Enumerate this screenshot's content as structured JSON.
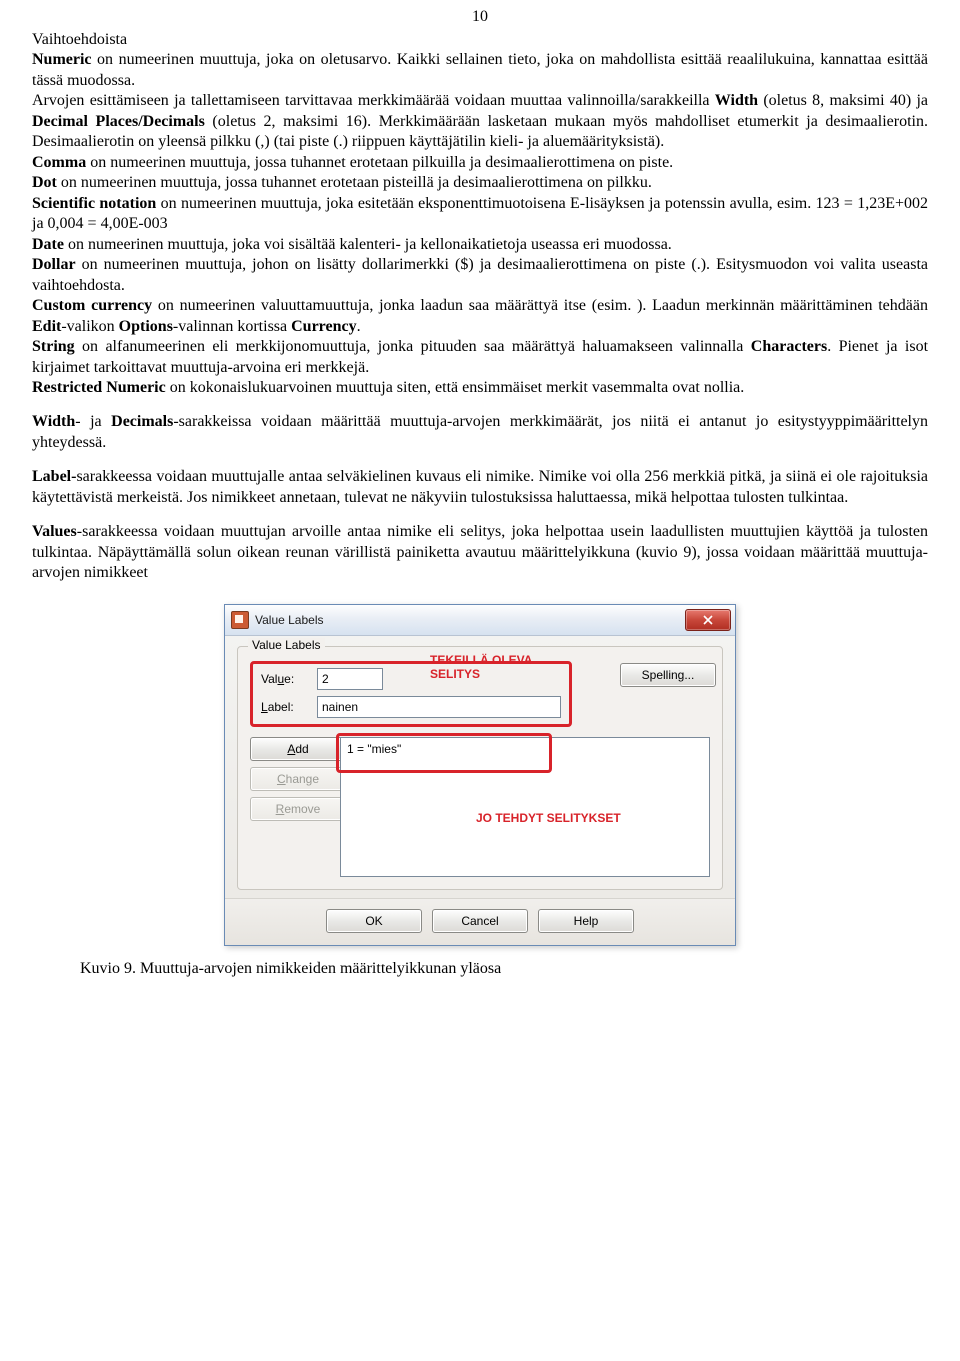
{
  "page_number": "10",
  "paragraphs": {
    "p1a": "Vaihtoehdoista",
    "p1b_label": "Numeric",
    "p1b": " on numeerinen muuttuja, joka on oletusarvo. Kaikki sellainen tieto, joka on mahdollista esittää reaalilukuina, kannattaa esittää tässä muodossa.",
    "p1c": "Arvojen esittämiseen ja tallettamiseen tarvittavaa merkkimäärää voidaan muuttaa valinnoilla/sarakkeilla ",
    "p1c_b1": "Width",
    "p1c_mid": " (oletus 8, maksimi 40) ja ",
    "p1c_b2": "Decimal Places/Decimals",
    "p1c_end": " (oletus 2, maksimi 16). Merkkimäärään lasketaan mukaan myös mahdolliset etumerkit ja desimaalierotin. Desimaalierotin on yleensä pilkku (,) (tai piste (.) riippuen käyttäjätilin kieli- ja aluemäärityksistä).",
    "p2_b": "Comma",
    "p2": " on numeerinen muuttuja, jossa tuhannet erotetaan pilkuilla ja desimaalierottimena on piste.",
    "p3_b": "Dot",
    "p3": " on numeerinen muuttuja, jossa tuhannet erotetaan pisteillä ja desimaalierottimena on pilkku.",
    "p4_b": "Scientific notation",
    "p4": " on numeerinen muuttuja, joka esitetään eksponenttimuotoisena E-lisäyksen ja potenssin avulla, esim. 123 = 1,23E+002  ja 0,004 = 4,00E-003",
    "p5_b": "Date",
    "p5": " on numeerinen muuttuja, joka voi sisältää kalenteri- ja kellonaikatietoja useassa eri muodossa.",
    "p6_b": "Dollar",
    "p6": " on numeerinen muuttuja, johon on lisätty dollarimerkki ($) ja desimaalierottimena on piste (.). Esitysmuodon voi valita useasta vaihtoehdosta.",
    "p7_b": "Custom currency",
    "p7a": " on numeerinen valuuttamuuttuja, jonka laadun saa määrättyä itse (esim. ). Laadun merkinnän määrittäminen tehdään ",
    "p7b_b1": "Edit",
    "p7b_mid1": "-valikon ",
    "p7b_b2": "Options",
    "p7b_mid2": "-valinnan kortissa ",
    "p7b_b3": "Currency",
    "p7b_end": ".",
    "p8_b": "String",
    "p8a": " on alfanumeerinen eli merkkijonomuuttuja, jonka pituuden saa määrättyä haluamakseen valinnalla ",
    "p8b_b": "Characters",
    "p8b_end": ". Pienet ja isot kirjaimet tarkoittavat muuttuja-arvoina eri merkkejä.",
    "p9_b": "Restricted Numeric",
    "p9": " on kokonaislukuarvoinen muuttuja siten, että ensimmäiset merkit vasemmalta ovat nollia.",
    "p10_b1": "Width",
    "p10_mid": "- ja ",
    "p10_b2": "Decimals",
    "p10": "-sarakkeissa voidaan määrittää muuttuja-arvojen merkkimäärät, jos niitä ei antanut jo esitystyyppimäärittelyn yhteydessä.",
    "p11_b": "Label-",
    "p11": "sarakkeessa voidaan muuttujalle antaa selväkielinen kuvaus eli nimike. Nimike voi olla 256 merkkiä pitkä, ja siinä ei ole rajoituksia käytettävistä merkeistä. Jos nimikkeet annetaan, tulevat ne näkyviin tulostuksissa haluttaessa, mikä helpottaa tulosten tulkintaa.",
    "p12_b": "Values",
    "p12": "-sarakkeessa voidaan muuttujan arvoille antaa nimike eli selitys, joka helpottaa usein laadullisten muuttujien käyttöä ja tulosten tulkintaa. Näpäyttämällä solun oikean reunan värillistä painiketta  avautuu määrittelyikkuna (kuvio 9), jossa voidaan määrittää muuttuja-arvojen nimikkeet"
  },
  "dialog": {
    "title": "Value Labels",
    "group_label": "Value Labels",
    "value_label": "Value:",
    "value_input": "2",
    "label_label": "Label:",
    "label_input": "nainen",
    "spelling_btn": "Spelling...",
    "add_btn": "Add",
    "change_btn": "Change",
    "remove_btn": "Remove",
    "list_item": "1 = \"mies\"",
    "ok_btn": "OK",
    "cancel_btn": "Cancel",
    "help_btn": "Help",
    "annotation_top": "TEKEILLÄ OLEVA SELITYS",
    "annotation_mid": "JO TEHDYT SELITYKSET"
  },
  "caption": "Kuvio 9.  Muuttuja-arvojen nimikkeiden määrittelyikkunan yläosa"
}
